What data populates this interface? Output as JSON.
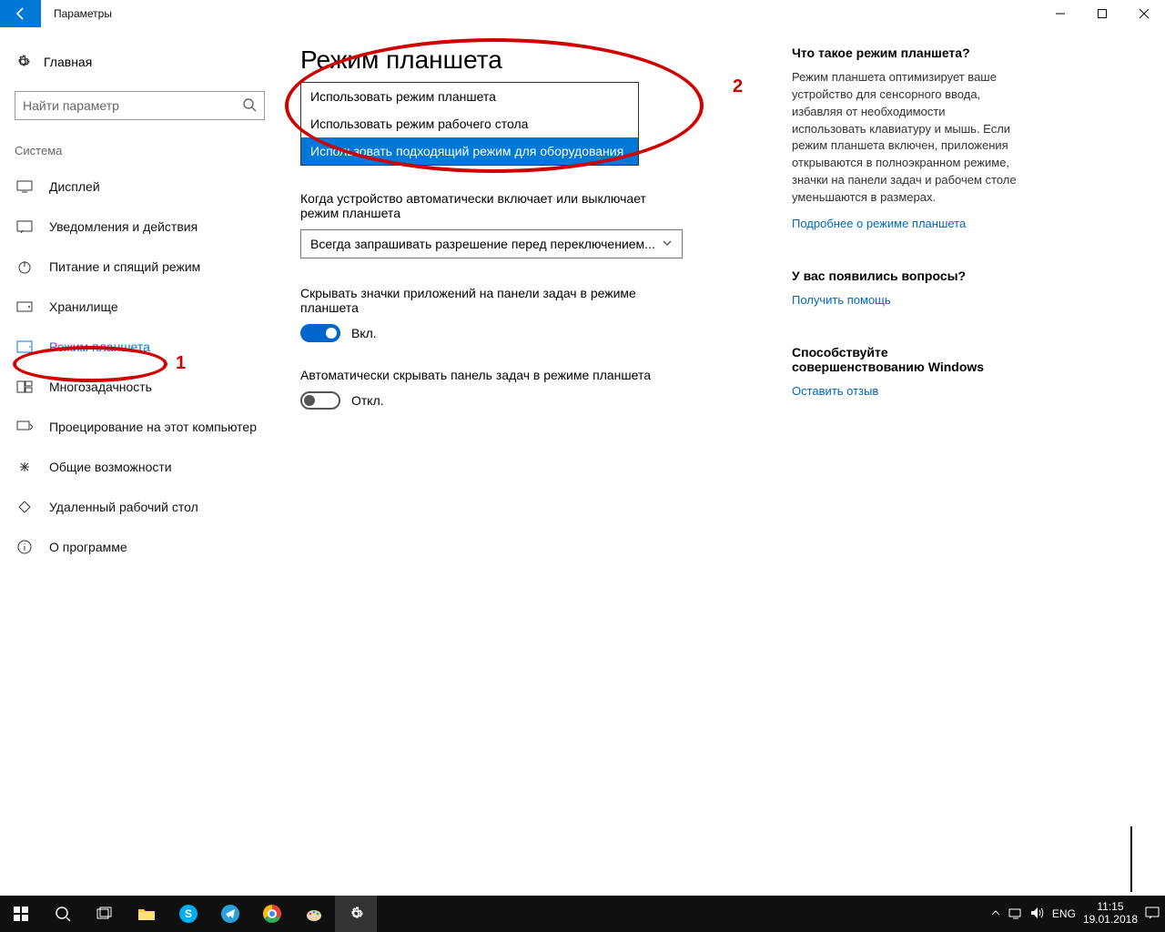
{
  "titlebar": {
    "title": "Параметры"
  },
  "sidebar": {
    "home": "Главная",
    "search_placeholder": "Найти параметр",
    "group": "Система",
    "items": [
      {
        "icon": "display",
        "label": "Дисплей"
      },
      {
        "icon": "notify",
        "label": "Уведомления и действия"
      },
      {
        "icon": "power",
        "label": "Питание и спящий режим"
      },
      {
        "icon": "storage",
        "label": "Хранилище"
      },
      {
        "icon": "tablet",
        "label": "Режим планшета",
        "active": true
      },
      {
        "icon": "multi",
        "label": "Многозадачность"
      },
      {
        "icon": "project",
        "label": "Проецирование на этот компьютер"
      },
      {
        "icon": "shared",
        "label": "Общие возможности"
      },
      {
        "icon": "remote",
        "label": "Удаленный рабочий стол"
      },
      {
        "icon": "about",
        "label": "О программе"
      }
    ]
  },
  "content": {
    "title": "Режим планшета",
    "dropdown_options": [
      "Использовать режим планшета",
      "Использовать режим рабочего стола",
      "Использовать подходящий режим для оборудования"
    ],
    "second_label": "Когда устройство автоматически включает или выключает режим планшета",
    "second_value": "Всегда запрашивать разрешение перед переключением...",
    "setting1_label": "Скрывать значки приложений на панели задач в режиме планшета",
    "setting1_toggle": "Вкл.",
    "setting2_label": "Автоматически скрывать панель задач в режиме планшета",
    "setting2_toggle": "Откл."
  },
  "info": {
    "about_title": "Что такое режим планшета?",
    "about_text": "Режим планшета оптимизирует ваше устройство для сенсорного ввода, избавляя от необходимости использовать клавиатуру и мышь. Если режим планшета включен, приложения открываются в полноэкранном режиме, значки на панели задач и рабочем столе уменьшаются в размерах.",
    "about_link": "Подробнее о режиме планшета",
    "help_title": "У вас появились вопросы?",
    "help_link": "Получить помощь",
    "feedback_title": "Способствуйте совершенствованию Windows",
    "feedback_link": "Оставить отзыв"
  },
  "annotations": {
    "one": "1",
    "two": "2"
  },
  "taskbar": {
    "lang": "ENG",
    "time": "11:15",
    "date": "19.01.2018"
  }
}
